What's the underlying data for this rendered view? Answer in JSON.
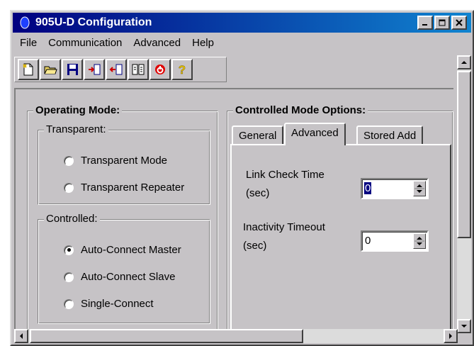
{
  "window": {
    "title": "905U-D Configuration"
  },
  "menu": {
    "items": [
      "File",
      "Communication",
      "Advanced",
      "Help"
    ]
  },
  "toolbar": {
    "icons": [
      "new-file-icon",
      "open-folder-icon",
      "save-disk-icon",
      "download-icon",
      "upload-icon",
      "compare-icon",
      "reset-icon",
      "help-icon"
    ]
  },
  "operating_mode": {
    "title": "Operating Mode:",
    "transparent": {
      "title": "Transparent:",
      "options": [
        "Transparent Mode",
        "Transparent Repeater"
      ],
      "selected": null
    },
    "controlled": {
      "title": "Controlled:",
      "options": [
        "Auto-Connect Master",
        "Auto-Connect Slave",
        "Single-Connect"
      ],
      "selected": "Auto-Connect Master"
    }
  },
  "controlled_options": {
    "title": "Controlled Mode Options:",
    "tabs": [
      "General",
      "Advanced",
      "Stored Add"
    ],
    "active_tab": "Advanced",
    "fields": [
      {
        "label_line1": "Link Check Time",
        "label_line2": "(sec)",
        "value": "0",
        "focused": true
      },
      {
        "label_line1": "Inactivity Timeout",
        "label_line2": "(sec)",
        "value": "0",
        "focused": false
      }
    ]
  },
  "colors": {
    "face": "#c6c3c6",
    "title_start": "#000080",
    "title_end": "#1084d0"
  }
}
